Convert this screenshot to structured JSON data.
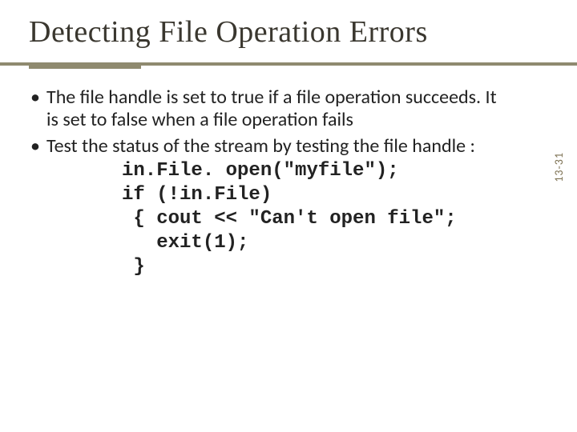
{
  "slide": {
    "title": "Detecting File Operation Errors",
    "bullets": [
      "The file handle is set to true if a file operation succeeds.  It is set to false when a file operation fails",
      "Test the status of the stream by testing the file handle :"
    ],
    "code": "in.File. open(\"myfile\");\nif (!in.File)\n { cout << \"Can't open file\";\n   exit(1);\n }",
    "page_number": "13-31"
  }
}
